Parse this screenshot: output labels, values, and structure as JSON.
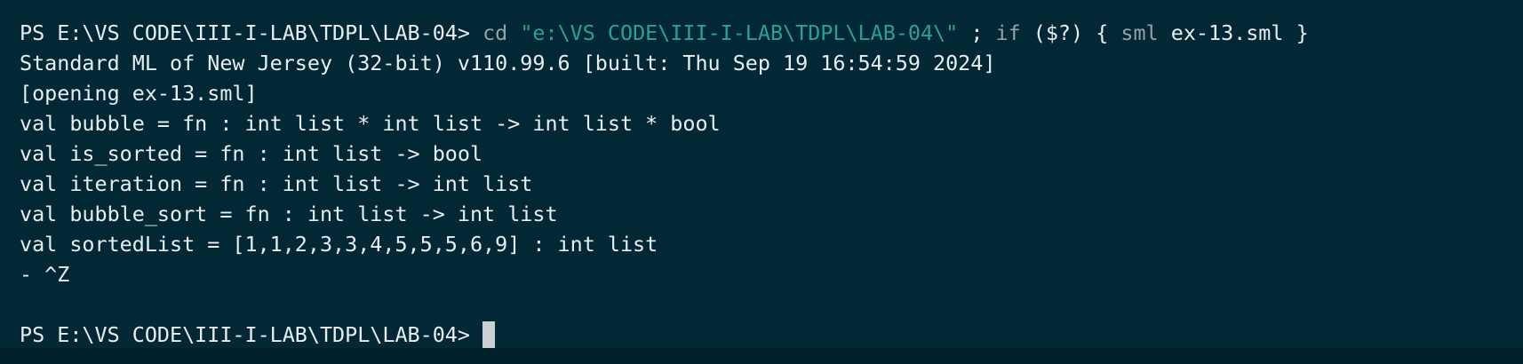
{
  "terminal": {
    "command_line": {
      "prompt": "PS E:\\VS CODE\\III-I-LAB\\TDPL\\LAB-04>",
      "cmd": "cd",
      "path_arg": "\"e:\\VS CODE\\III-I-LAB\\TDPL\\LAB-04\\\"",
      "sep": ";",
      "if_kw": "if",
      "condition": "($?)",
      "open_brace": "{",
      "sml_cmd": "sml",
      "file_arg": "ex-13.sml",
      "close_brace": "}"
    },
    "output": [
      "Standard ML of New Jersey (32-bit) v110.99.6 [built: Thu Sep 19 16:54:59 2024]",
      "[opening ex-13.sml]",
      "val bubble = fn : int list * int list -> int list * bool",
      "val is_sorted = fn : int list -> bool",
      "val iteration = fn : int list -> int list",
      "val bubble_sort = fn : int list -> int list",
      "val sortedList = [1,1,2,3,3,4,5,5,5,6,9] : int list",
      "- ^Z"
    ],
    "final_prompt": "PS E:\\VS CODE\\III-I-LAB\\TDPL\\LAB-04>"
  },
  "colors": {
    "background": "#012834",
    "text": "#e8eef0",
    "dim_text": "#94a1a6",
    "string": "#2aa198"
  }
}
